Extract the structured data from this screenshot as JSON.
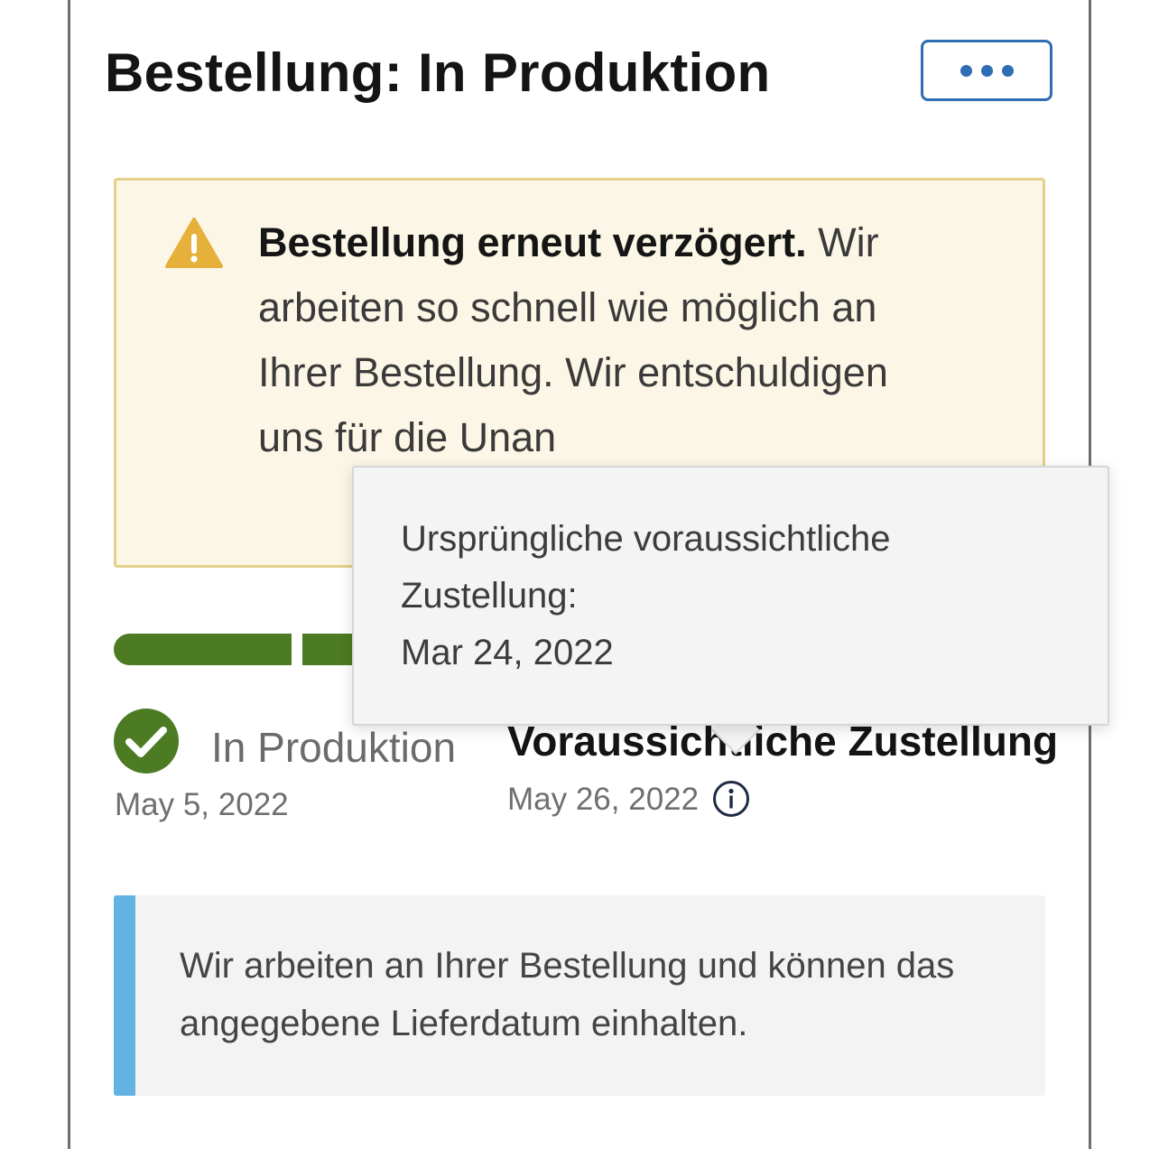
{
  "header": {
    "title": "Bestellung: In Produktion",
    "more_icon": "more-horizontal-icon"
  },
  "alert": {
    "icon": "warning-icon",
    "bold_text": "Bestellung erneut verzögert.",
    "body_text": " Wir arbeiten so schnell wie möglich an Ihrer Bestellung. Wir entschuldigen uns für die Unan"
  },
  "progress": {
    "completed_segments": 2
  },
  "step": {
    "icon": "check-circle-icon",
    "label": "In Produktion",
    "date": "May 5, 2022"
  },
  "delivery": {
    "label": "Voraussichtliche Zustellung",
    "date": "May 26, 2022",
    "info_icon": "info-icon"
  },
  "tooltip": {
    "line1": "Ursprüngliche voraussichtliche",
    "line2": "Zustellung:",
    "line3": "Mar 24, 2022"
  },
  "note": {
    "text": "Wir arbeiten an Ihrer Bestellung und können das angegebene Lieferdatum einhalten."
  },
  "colors": {
    "accent_blue": "#2f6db5",
    "progress_green": "#4c7b23",
    "warning_yellow": "#e5b13b",
    "alert_bg": "#fcf6e6",
    "note_bar": "#62b2e3"
  }
}
